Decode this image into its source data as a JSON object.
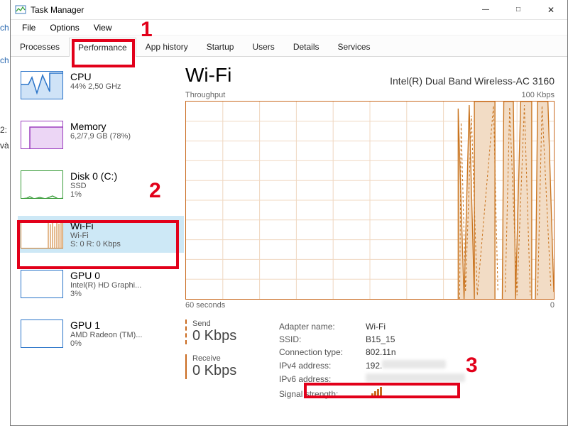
{
  "window": {
    "title": "Task Manager"
  },
  "menu": {
    "file": "File",
    "options": "Options",
    "view": "View"
  },
  "tabs": {
    "processes": "Processes",
    "performance": "Performance",
    "app_history": "App history",
    "startup": "Startup",
    "users": "Users",
    "details": "Details",
    "services": "Services",
    "active": "performance"
  },
  "sidebar": [
    {
      "id": "cpu",
      "title": "CPU",
      "line2": "44%  2,50 GHz",
      "line3": "",
      "color": "#2a74c9"
    },
    {
      "id": "memory",
      "title": "Memory",
      "line2": "6,2/7,9 GB (78%)",
      "line3": "",
      "color": "#9b3fbf"
    },
    {
      "id": "disk0",
      "title": "Disk 0 (C:)",
      "line2": "SSD",
      "line3": "1%",
      "color": "#3a9c3a"
    },
    {
      "id": "wifi",
      "title": "Wi-Fi",
      "line2": "Wi-Fi",
      "line3": "S: 0 R: 0 Kbps",
      "color": "#c9741f",
      "selected": true
    },
    {
      "id": "gpu0",
      "title": "GPU 0",
      "line2": "Intel(R) HD Graphi...",
      "line3": "3%",
      "color": "#2a74c9"
    },
    {
      "id": "gpu1",
      "title": "GPU 1",
      "line2": "AMD Radeon (TM)...",
      "line3": "0%",
      "color": "#2a74c9"
    }
  ],
  "detail": {
    "title": "Wi-Fi",
    "adapter": "Intel(R) Dual Band Wireless-AC 3160",
    "graph_label": "Throughput",
    "graph_max": "100 Kbps",
    "graph_timespan": "60 seconds",
    "graph_zero": "0",
    "send_label": "Send",
    "send_value": "0 Kbps",
    "receive_label": "Receive",
    "receive_value": "0 Kbps",
    "props": {
      "adapter_name_k": "Adapter name:",
      "adapter_name_v": "Wi-Fi",
      "ssid_k": "SSID:",
      "ssid_v": "B15_15",
      "conn_type_k": "Connection type:",
      "conn_type_v": "802.11n",
      "ipv4_k": "IPv4 address:",
      "ipv4_v": "192.",
      "ipv6_k": "IPv6 address:",
      "ipv6_v": "",
      "sig_k": "Signal strength:"
    }
  },
  "annotations": {
    "n1": "1",
    "n2": "2",
    "n3": "3"
  },
  "bg": {
    "a": "ch",
    "b": "ch",
    "c": "2:",
    "d": "và"
  }
}
